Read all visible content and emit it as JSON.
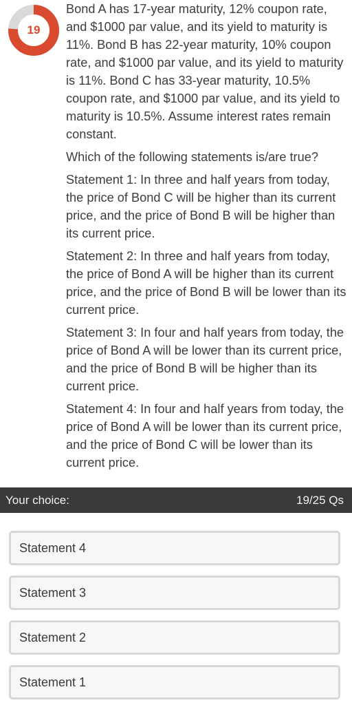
{
  "progress": {
    "current_question": "19",
    "fraction_complete": 0.76,
    "colors": {
      "fill": "#d94a2e",
      "track": "#d9d9d9"
    }
  },
  "question": {
    "intro": "Bond A has 17-year maturity, 12% coupon rate, and $1000 par value, and its yield to maturity is 11%. Bond B has 22-year maturity, 10% coupon rate, and $1000 par value, and its yield to maturity is 11%. Bond C has 33-year maturity, 10.5% coupon rate, and $1000 par value, and its yield to maturity is 10.5%. Assume interest rates remain constant.",
    "prompt": "Which of the following statements is/are true?",
    "statements": [
      "Statement 1:  In three and half years from today, the price of Bond C will be higher than its current price, and the price of Bond B will be higher than its current price.",
      "Statement 2: In three and half years from today, the price of Bond A will be higher than its current price, and the price of Bond B will be lower than its current price.",
      "Statement 3: In four and half years from today, the price of Bond A will be lower than its current price, and the price of Bond B will be higher than its current price.",
      "Statement 4: In four and half years from today, the price of Bond A will be lower than its current price, and the price of Bond C will be lower than its current price."
    ]
  },
  "choice_bar": {
    "label": "Your choice:",
    "count": "19/25 Qs",
    "background": "#3a3a3a"
  },
  "options": [
    {
      "label": "Statement 4"
    },
    {
      "label": "Statement 3"
    },
    {
      "label": "Statement 2"
    },
    {
      "label": "Statement 1"
    }
  ]
}
